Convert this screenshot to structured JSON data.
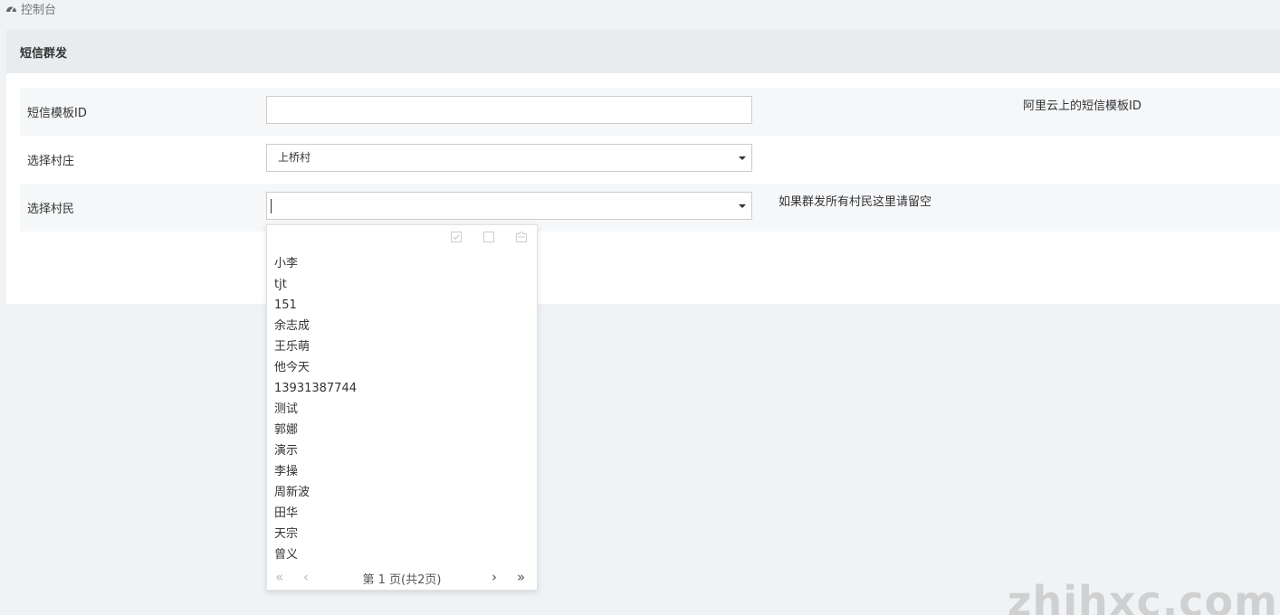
{
  "breadcrumb": {
    "icon": "dashboard-icon",
    "label": "控制台"
  },
  "panel": {
    "title": "短信群发"
  },
  "form": {
    "template_id": {
      "label": "短信模板ID",
      "value": "",
      "help": "阿里云上的短信模板ID"
    },
    "village": {
      "label": "选择村庄",
      "selected": "上桥村"
    },
    "villager": {
      "label": "选择村民",
      "value": "",
      "help": "如果群发所有村民这里请留空"
    }
  },
  "dropdown": {
    "toolbar": [
      "select-all-icon",
      "unselect-all-icon",
      "clear-icon"
    ],
    "items": [
      "小李",
      "tjt",
      "151",
      "余志成",
      "王乐萌",
      "他今天",
      "13931387744",
      "测试",
      "郭娜",
      "演示",
      "李操",
      "周新波",
      "田华",
      "天宗",
      "曾义"
    ],
    "pagination": {
      "info": "第 1 页(共2页)",
      "first": "«",
      "prev": "‹",
      "next": "›",
      "last": "»"
    }
  },
  "watermark": "zhihxc.com"
}
